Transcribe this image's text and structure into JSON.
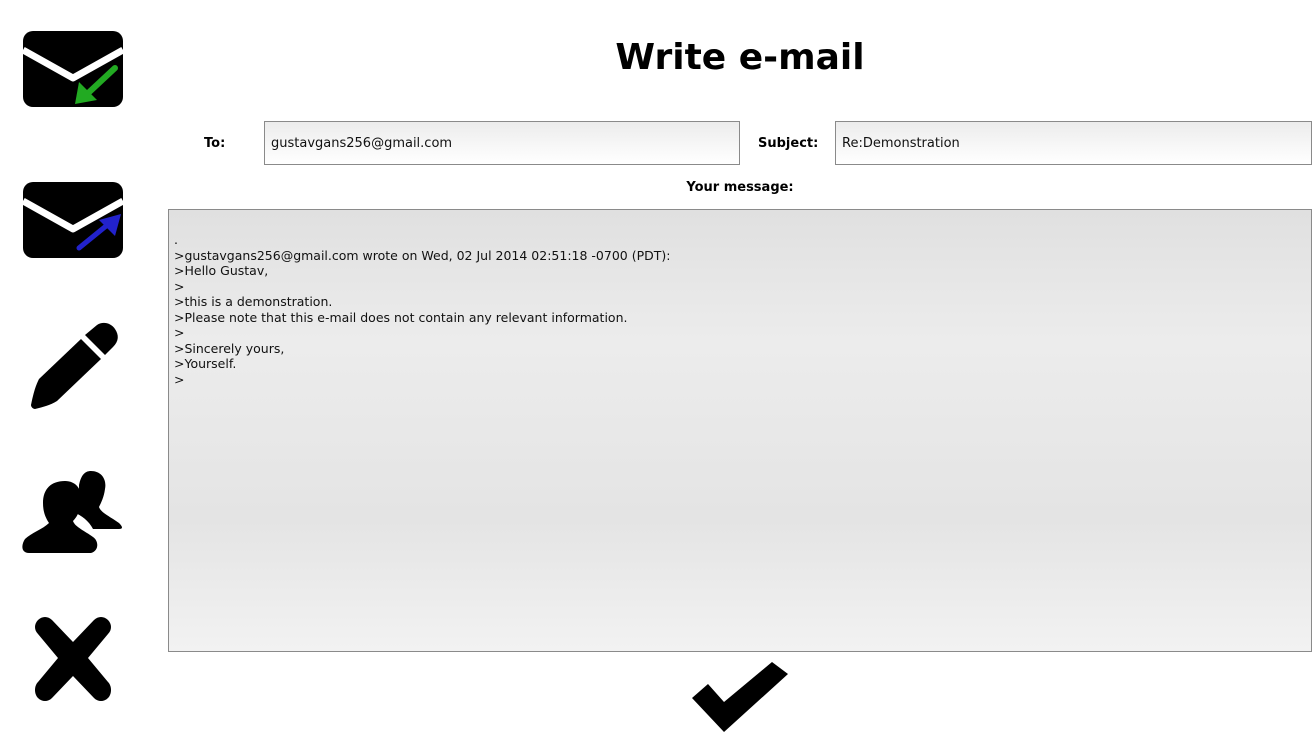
{
  "header": {
    "title": "Write e-mail"
  },
  "sidebar": {
    "items": [
      {
        "name": "inbox",
        "icon": "envelope-incoming-icon",
        "accent": "#22aa22"
      },
      {
        "name": "outbox",
        "icon": "envelope-outgoing-icon",
        "accent": "#2222cc"
      },
      {
        "name": "compose",
        "icon": "pencil-icon"
      },
      {
        "name": "contacts",
        "icon": "people-icon"
      },
      {
        "name": "close",
        "icon": "close-icon"
      }
    ]
  },
  "form": {
    "to_label": "To:",
    "to_value": "gustavgans256@gmail.com",
    "subject_label": "Subject:",
    "subject_value": "Re:Demonstration",
    "message_label": "Your message:",
    "message_value": ".\n>gustavgans256@gmail.com wrote on Wed, 02 Jul 2014 02:51:18 -0700 (PDT):\n>Hello Gustav,\n>\n>this is a demonstration.\n>Please note that this e-mail does not contain any relevant information.\n>\n>Sincerely yours,\n>Yourself.\n>"
  },
  "actions": {
    "send_icon": "checkmark-icon"
  }
}
